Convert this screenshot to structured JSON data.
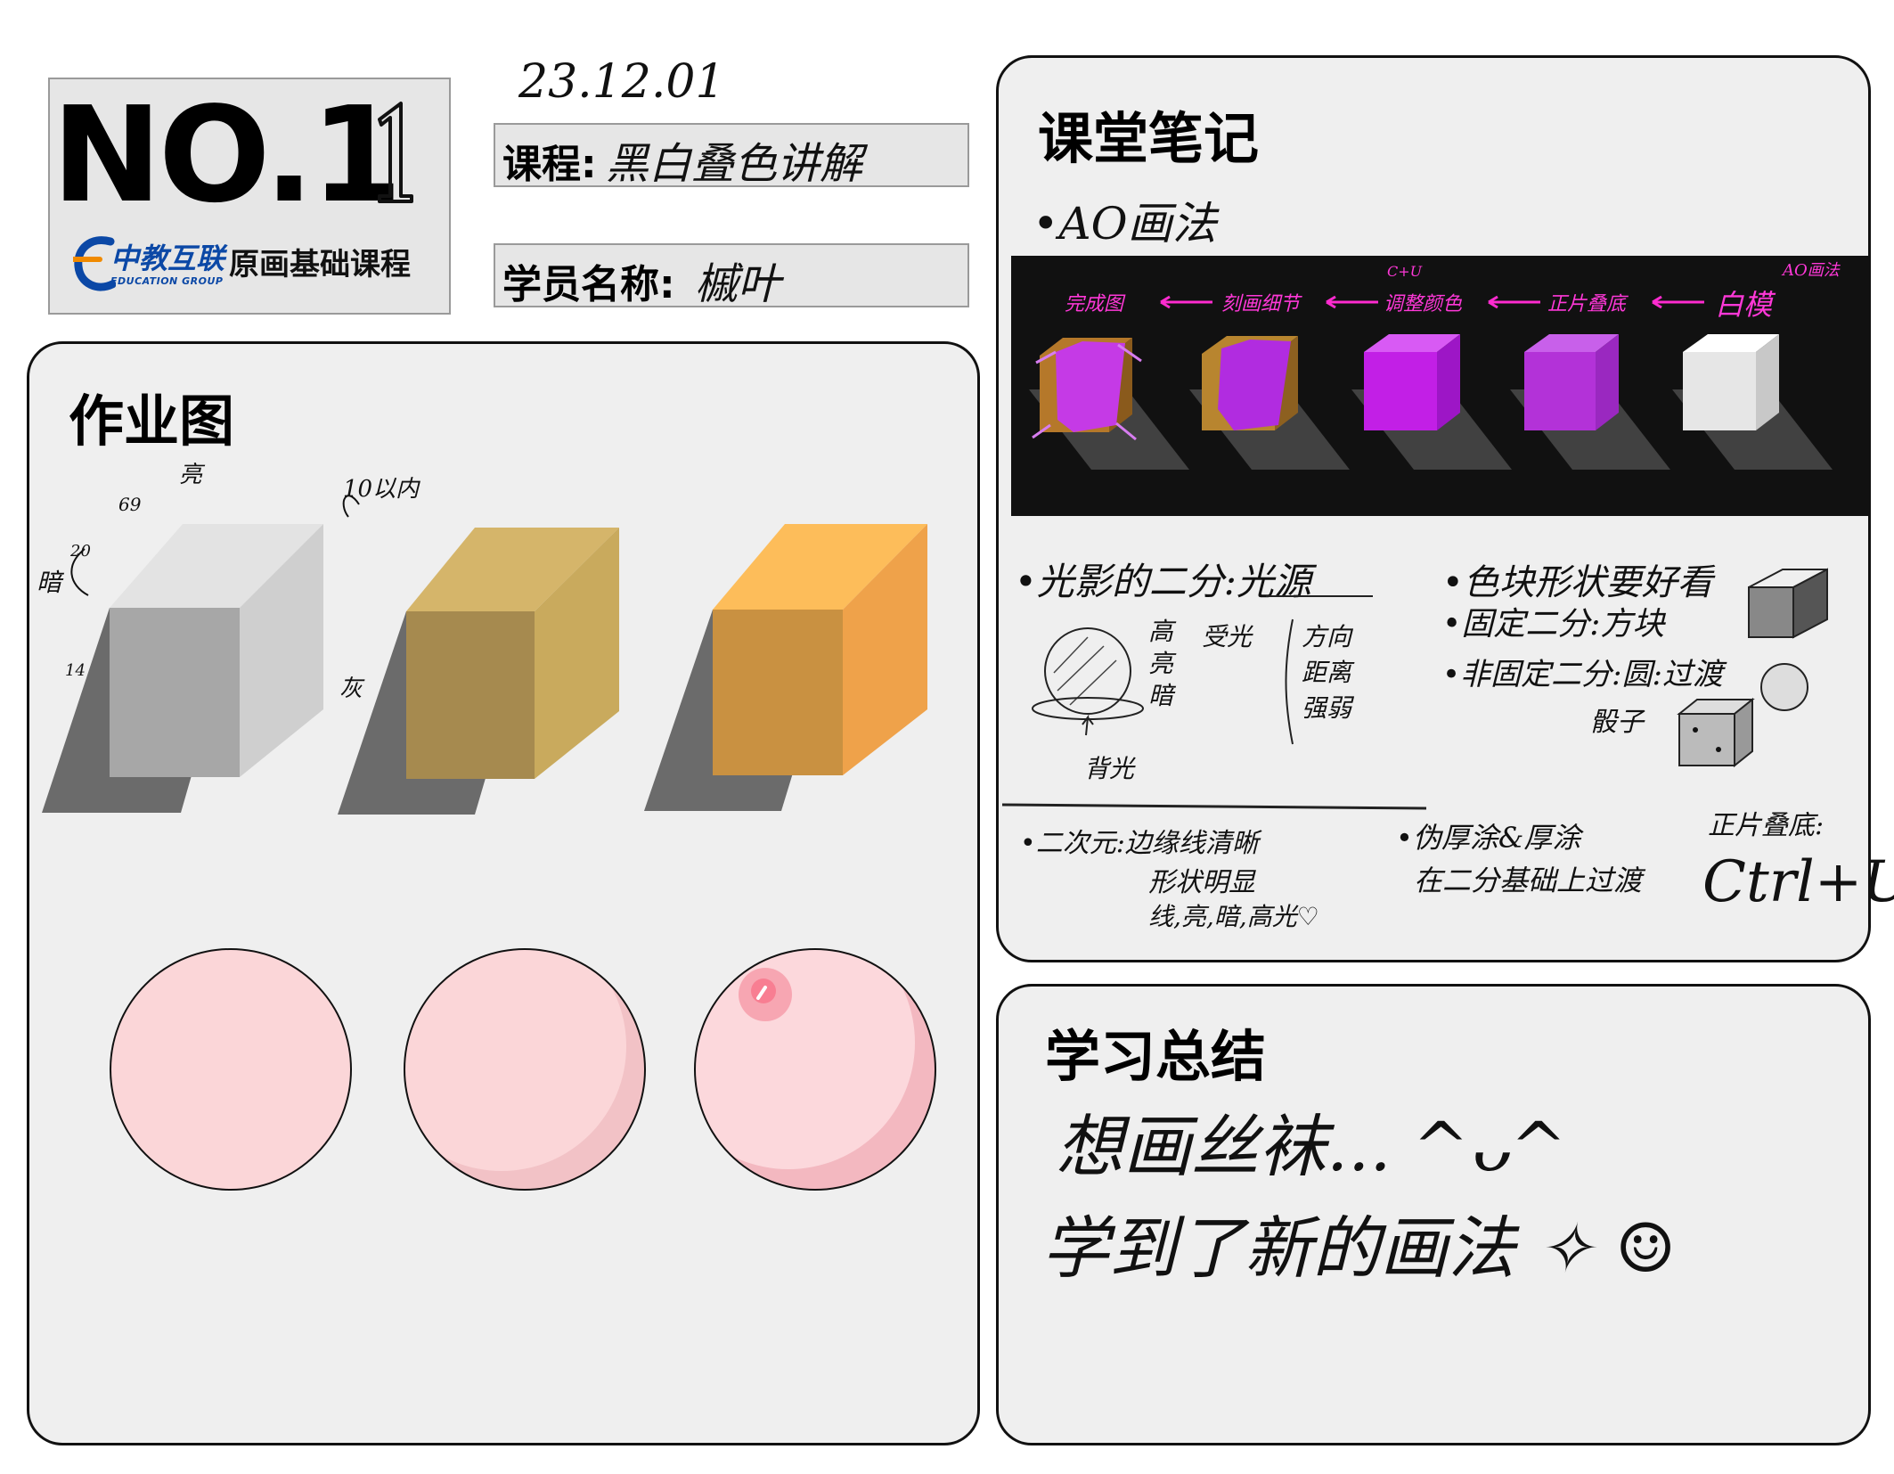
{
  "header": {
    "number_label": "NO.1",
    "number_handwritten": "1",
    "logo_name": "中教互联",
    "logo_sub": "EDUCATION GROUP",
    "logo_course": "原画基础课程",
    "date": "23.12.01",
    "course_label": "课程:",
    "course_value": "黑白叠色讲解",
    "student_label": "学员名称:",
    "student_value": "槭叶"
  },
  "homework": {
    "title": "作业图",
    "annotations": {
      "bright": "亮",
      "bright_value": "69",
      "dark": "暗",
      "dark_value": "20",
      "range": "10以内",
      "gray": "灰",
      "shadow_value": "14"
    },
    "boxes": [
      "#a7a7a7",
      "#a68a4f",
      "#c99141"
    ],
    "spheres": [
      "#fbd6d8",
      "#f4c4c8",
      "#f3b8c0"
    ]
  },
  "notes": {
    "title": "课堂笔记",
    "ao_heading": "•AO画法",
    "pipeline": {
      "steps": [
        "完成图",
        "刻画细节",
        "调整颜色",
        "正片叠底",
        "白模"
      ],
      "step_note_top": "C+U",
      "corner_note": "AO画法",
      "colors": [
        "#c53ae6",
        "#b12ce0",
        "#c21fe6",
        "#b332d8",
        "#ffffff"
      ]
    },
    "light_heading": "•光影的二分:光源",
    "light_items": [
      "高",
      "亮",
      "暗"
    ],
    "light_arrow": "受光",
    "light_props": [
      "方向",
      "距离",
      "强弱"
    ],
    "backlight": "背光",
    "color_shape": "•色块形状要好看",
    "fixed_split": "•固定二分:方块",
    "unfixed_split": "•非固定二分:圆:过渡",
    "dice": "骰子",
    "anime_line1": "•二次元:边缘线清晰",
    "anime_line2": "形状明显",
    "anime_line3": "线,亮,暗,高光♡",
    "thick_line1": "•伪厚涂&厚涂",
    "thick_line2": "在二分基础上过渡",
    "multiply_label": "正片叠底:",
    "shortcut": "Ctrl+U"
  },
  "summary": {
    "title": "学习总结",
    "line1": "想画丝袜... ^ᴗ^",
    "line2": "学到了新的画法 ✧ ☺"
  }
}
